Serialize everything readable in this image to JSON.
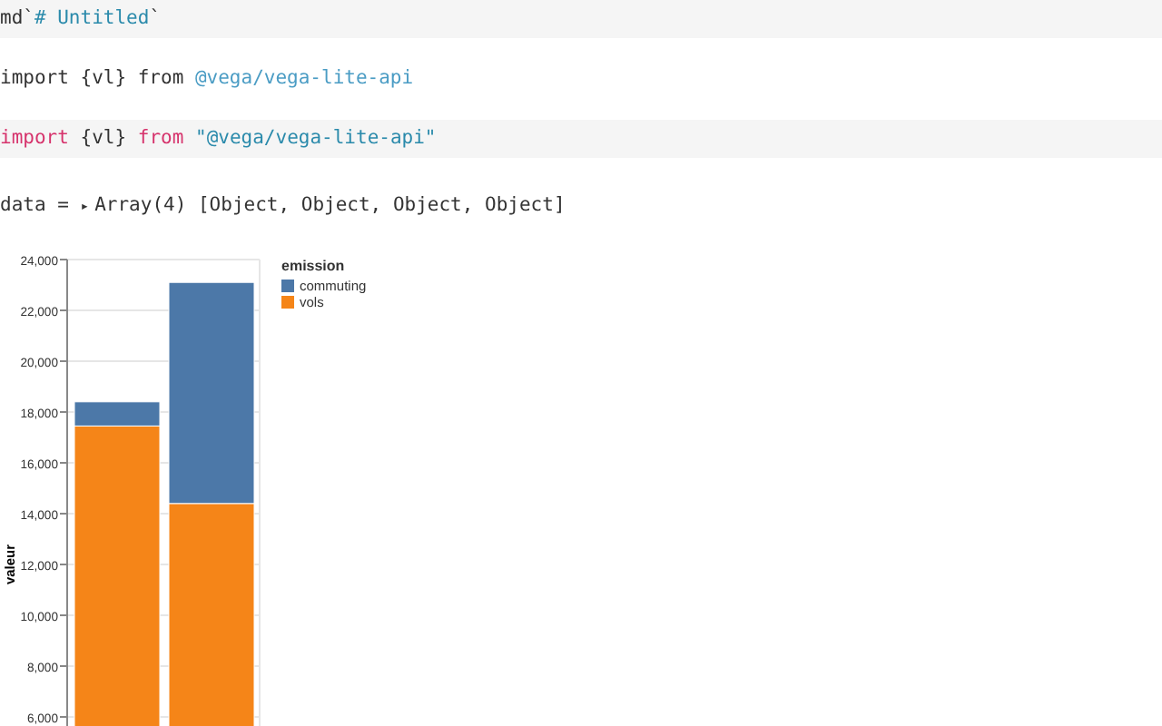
{
  "cells": [
    {
      "kind": "source",
      "segments": [
        {
          "text": "md`",
          "kind": "plain"
        },
        {
          "text": "# Untitled",
          "kind": "string"
        },
        {
          "text": "`",
          "kind": "plain"
        }
      ]
    },
    {
      "kind": "output",
      "segments": [
        {
          "text": "import {vl} from ",
          "kind": "plain"
        },
        {
          "text": "@vega/vega-lite-api",
          "kind": "link"
        }
      ]
    },
    {
      "kind": "source",
      "segments": [
        {
          "text": "import",
          "kind": "keyword"
        },
        {
          "text": " {vl} ",
          "kind": "plain"
        },
        {
          "text": "from",
          "kind": "keyword"
        },
        {
          "text": " \"@vega/vega-lite-api\"",
          "kind": "string"
        }
      ]
    }
  ],
  "data_line": {
    "prefix": "data = ",
    "toggle": "▸",
    "value": "Array(4) [Object, Object, Object, Object]"
  },
  "chart_data": {
    "type": "bar",
    "stacked": true,
    "grid": true,
    "ylabel": "valeur",
    "ylim": [
      0,
      24000
    ],
    "yticks": [
      {
        "value": 6000,
        "label": "6,000"
      },
      {
        "value": 8000,
        "label": "8,000"
      },
      {
        "value": 10000,
        "label": "10,000"
      },
      {
        "value": 12000,
        "label": "12,000"
      },
      {
        "value": 14000,
        "label": "14,000"
      },
      {
        "value": 16000,
        "label": "16,000"
      },
      {
        "value": 18000,
        "label": "18,000"
      },
      {
        "value": 20000,
        "label": "20,000"
      },
      {
        "value": 22000,
        "label": "22,000"
      },
      {
        "value": 24000,
        "label": "24,000"
      }
    ],
    "legend_title": "emission",
    "series": [
      {
        "name": "commuting",
        "color": "#4c78a8",
        "values": [
          950,
          8700
        ]
      },
      {
        "name": "vols",
        "color": "#f58518",
        "values": [
          17450,
          14400
        ]
      }
    ]
  }
}
